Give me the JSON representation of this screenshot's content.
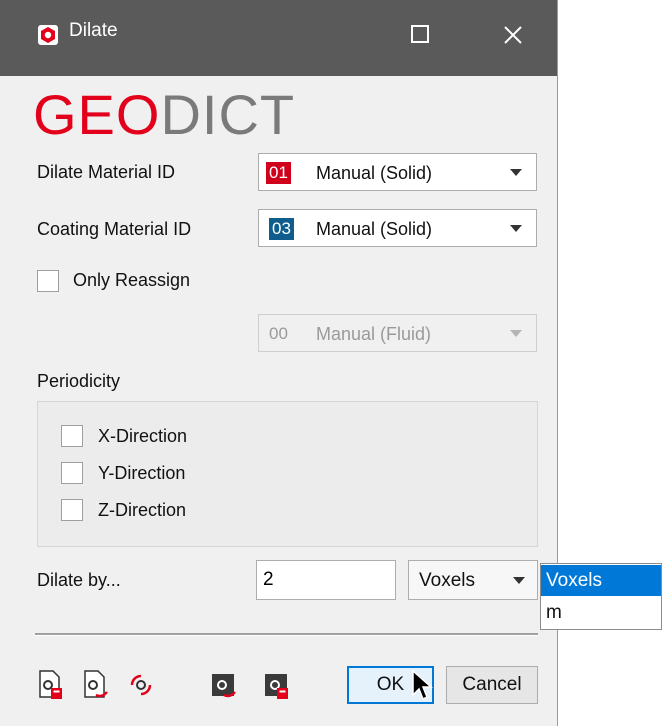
{
  "window": {
    "title": "Dilate",
    "app_icon": "geodict-app-icon",
    "controls": [
      "maximize-icon",
      "close-icon"
    ]
  },
  "logo": {
    "part1": "GEO",
    "part2": "DICT",
    "color_geo": "#e2001a",
    "color_dict": "#7a7a7a"
  },
  "dilate_material": {
    "label": "Dilate Material ID",
    "id": "01",
    "value": "Manual (Solid)",
    "chip_color": "#d0021b"
  },
  "coating_material": {
    "label": "Coating Material ID",
    "id": "03",
    "value": "Manual (Solid)",
    "chip_color": "#0f5d8c"
  },
  "only_reassign": {
    "label": "Only Reassign",
    "checked": false
  },
  "reassign_material": {
    "id": "00",
    "value": "Manual (Fluid)",
    "enabled": false
  },
  "periodicity": {
    "label": "Periodicity",
    "directions": [
      {
        "label": "X-Direction",
        "checked": false
      },
      {
        "label": "Y-Direction",
        "checked": false
      },
      {
        "label": "Z-Direction",
        "checked": false
      }
    ]
  },
  "dilate_by": {
    "label": "Dilate by...",
    "value": "2",
    "unit": "Voxels",
    "unit_options": [
      "Voxels",
      "m"
    ],
    "highlighted_option": "Voxels"
  },
  "toolbar_icons": [
    "load-settings-icon",
    "save-settings-icon",
    "reset-settings-icon",
    "record-macro-icon",
    "record-macro-settings-icon"
  ],
  "buttons": {
    "ok": "OK",
    "cancel": "Cancel"
  }
}
